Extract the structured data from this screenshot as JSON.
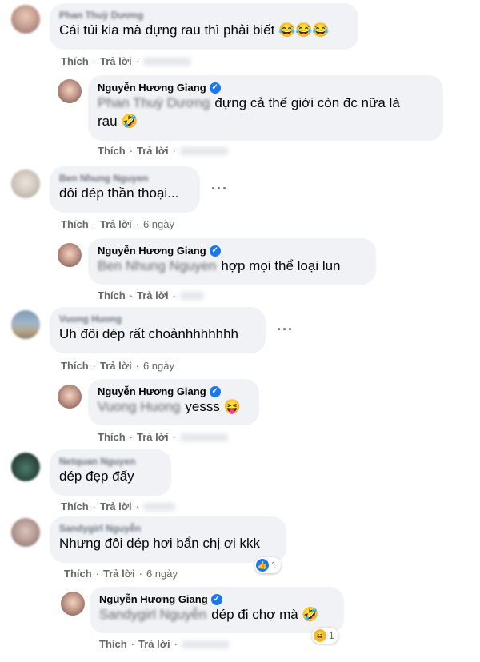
{
  "actions": {
    "like": "Thích",
    "reply": "Trả lời",
    "sep": "·"
  },
  "colors": {
    "bubble": "#f0f2f5",
    "verified": "#1877f2",
    "meta": "#65676b"
  },
  "comments": [
    {
      "author": "Phan Thuỳ Dương",
      "text": "Cái túi kia mà đựng rau thì phải biết 😂😂😂",
      "time": "",
      "reply": {
        "author": "Nguyễn Hương Giang",
        "tag": "Phan Thuỳ Dương",
        "text_line1": "đựng cả thế giới còn đc nữa là",
        "text_line2": "rau 🤣",
        "time": ""
      }
    },
    {
      "author": "Ben Nhung Nguyen",
      "text": "đôi dép thần thoại...",
      "time": "6 ngày",
      "reply": {
        "author": "Nguyễn Hương Giang",
        "tag": "Ben Nhung Nguyen",
        "text": "hợp mọi thể loại lun",
        "time": ""
      }
    },
    {
      "author": "Vuong Huong",
      "text": "Uh đôi dép rất choảnhhhhhhh",
      "time": "6 ngày",
      "reply": {
        "author": "Nguyễn Hương Giang",
        "tag": "Vuong Huong",
        "text": "yesss 😝",
        "time": ""
      }
    },
    {
      "author": "Netquan Nguyen",
      "text": "dép đẹp đấy",
      "time": ""
    },
    {
      "author": "Sandygirl Nguyễn",
      "text": "Nhưng đôi dép hơi bẩn chị ơi kkk",
      "time": "6 ngày",
      "reaction_count": "1",
      "reaction_icon": "like-icon",
      "reply": {
        "author": "Nguyễn Hương Giang",
        "tag": "Sandygirl Nguyễn",
        "text": "dép đi chợ mà 🤣",
        "time": "",
        "reaction_count": "1",
        "reaction_icon": "haha-icon"
      }
    }
  ]
}
